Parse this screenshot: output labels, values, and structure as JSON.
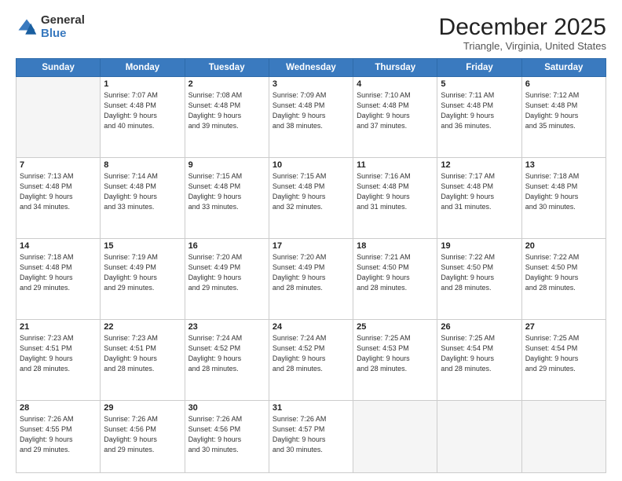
{
  "logo": {
    "general": "General",
    "blue": "Blue"
  },
  "header": {
    "month": "December 2025",
    "location": "Triangle, Virginia, United States"
  },
  "weekdays": [
    "Sunday",
    "Monday",
    "Tuesday",
    "Wednesday",
    "Thursday",
    "Friday",
    "Saturday"
  ],
  "rows": [
    [
      {
        "day": "",
        "empty": true
      },
      {
        "day": "1",
        "sunrise": "7:07 AM",
        "sunset": "4:48 PM",
        "daylight": "9 hours and 40 minutes."
      },
      {
        "day": "2",
        "sunrise": "7:08 AM",
        "sunset": "4:48 PM",
        "daylight": "9 hours and 39 minutes."
      },
      {
        "day": "3",
        "sunrise": "7:09 AM",
        "sunset": "4:48 PM",
        "daylight": "9 hours and 38 minutes."
      },
      {
        "day": "4",
        "sunrise": "7:10 AM",
        "sunset": "4:48 PM",
        "daylight": "9 hours and 37 minutes."
      },
      {
        "day": "5",
        "sunrise": "7:11 AM",
        "sunset": "4:48 PM",
        "daylight": "9 hours and 36 minutes."
      },
      {
        "day": "6",
        "sunrise": "7:12 AM",
        "sunset": "4:48 PM",
        "daylight": "9 hours and 35 minutes."
      }
    ],
    [
      {
        "day": "7",
        "sunrise": "7:13 AM",
        "sunset": "4:48 PM",
        "daylight": "9 hours and 34 minutes."
      },
      {
        "day": "8",
        "sunrise": "7:14 AM",
        "sunset": "4:48 PM",
        "daylight": "9 hours and 33 minutes."
      },
      {
        "day": "9",
        "sunrise": "7:15 AM",
        "sunset": "4:48 PM",
        "daylight": "9 hours and 33 minutes."
      },
      {
        "day": "10",
        "sunrise": "7:15 AM",
        "sunset": "4:48 PM",
        "daylight": "9 hours and 32 minutes."
      },
      {
        "day": "11",
        "sunrise": "7:16 AM",
        "sunset": "4:48 PM",
        "daylight": "9 hours and 31 minutes."
      },
      {
        "day": "12",
        "sunrise": "7:17 AM",
        "sunset": "4:48 PM",
        "daylight": "9 hours and 31 minutes."
      },
      {
        "day": "13",
        "sunrise": "7:18 AM",
        "sunset": "4:48 PM",
        "daylight": "9 hours and 30 minutes."
      }
    ],
    [
      {
        "day": "14",
        "sunrise": "7:18 AM",
        "sunset": "4:48 PM",
        "daylight": "9 hours and 29 minutes."
      },
      {
        "day": "15",
        "sunrise": "7:19 AM",
        "sunset": "4:49 PM",
        "daylight": "9 hours and 29 minutes."
      },
      {
        "day": "16",
        "sunrise": "7:20 AM",
        "sunset": "4:49 PM",
        "daylight": "9 hours and 29 minutes."
      },
      {
        "day": "17",
        "sunrise": "7:20 AM",
        "sunset": "4:49 PM",
        "daylight": "9 hours and 28 minutes."
      },
      {
        "day": "18",
        "sunrise": "7:21 AM",
        "sunset": "4:50 PM",
        "daylight": "9 hours and 28 minutes."
      },
      {
        "day": "19",
        "sunrise": "7:22 AM",
        "sunset": "4:50 PM",
        "daylight": "9 hours and 28 minutes."
      },
      {
        "day": "20",
        "sunrise": "7:22 AM",
        "sunset": "4:50 PM",
        "daylight": "9 hours and 28 minutes."
      }
    ],
    [
      {
        "day": "21",
        "sunrise": "7:23 AM",
        "sunset": "4:51 PM",
        "daylight": "9 hours and 28 minutes."
      },
      {
        "day": "22",
        "sunrise": "7:23 AM",
        "sunset": "4:51 PM",
        "daylight": "9 hours and 28 minutes."
      },
      {
        "day": "23",
        "sunrise": "7:24 AM",
        "sunset": "4:52 PM",
        "daylight": "9 hours and 28 minutes."
      },
      {
        "day": "24",
        "sunrise": "7:24 AM",
        "sunset": "4:52 PM",
        "daylight": "9 hours and 28 minutes."
      },
      {
        "day": "25",
        "sunrise": "7:25 AM",
        "sunset": "4:53 PM",
        "daylight": "9 hours and 28 minutes."
      },
      {
        "day": "26",
        "sunrise": "7:25 AM",
        "sunset": "4:54 PM",
        "daylight": "9 hours and 28 minutes."
      },
      {
        "day": "27",
        "sunrise": "7:25 AM",
        "sunset": "4:54 PM",
        "daylight": "9 hours and 29 minutes."
      }
    ],
    [
      {
        "day": "28",
        "sunrise": "7:26 AM",
        "sunset": "4:55 PM",
        "daylight": "9 hours and 29 minutes."
      },
      {
        "day": "29",
        "sunrise": "7:26 AM",
        "sunset": "4:56 PM",
        "daylight": "9 hours and 29 minutes."
      },
      {
        "day": "30",
        "sunrise": "7:26 AM",
        "sunset": "4:56 PM",
        "daylight": "9 hours and 30 minutes."
      },
      {
        "day": "31",
        "sunrise": "7:26 AM",
        "sunset": "4:57 PM",
        "daylight": "9 hours and 30 minutes."
      },
      {
        "day": "",
        "empty": true
      },
      {
        "day": "",
        "empty": true
      },
      {
        "day": "",
        "empty": true
      }
    ]
  ],
  "labels": {
    "sunrise": "Sunrise:",
    "sunset": "Sunset:",
    "daylight": "Daylight:"
  }
}
